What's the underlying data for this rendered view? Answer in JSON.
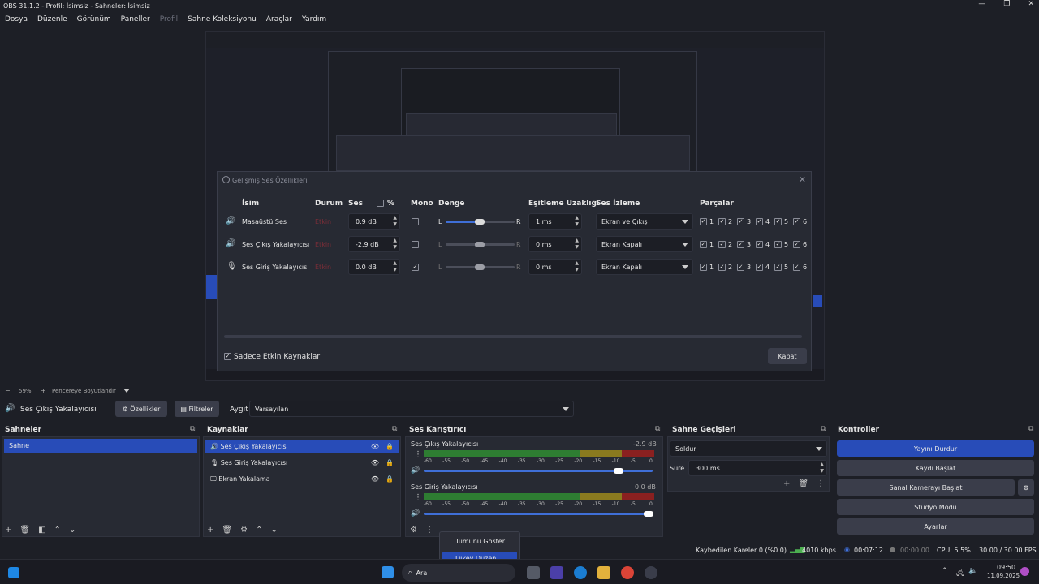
{
  "window": {
    "title": "OBS 31.1.2 - Profil: İsimsiz - Sahneler: İsimsiz",
    "controls": [
      "—",
      "❐",
      "✕"
    ]
  },
  "menu": {
    "items": [
      "Dosya",
      "Düzenle",
      "Görünüm",
      "Paneller",
      "Profil",
      "Sahne Koleksiyonu",
      "Araçlar",
      "Yardım"
    ]
  },
  "dialog": {
    "title": "Gelişmiş Ses Özellikleri",
    "headers": {
      "name": "İsim",
      "status": "Durum",
      "volume": "Ses",
      "percent": "%",
      "mono": "Mono",
      "balance": "Denge",
      "sync": "Eşitleme Uzaklığı",
      "monitor": "Ses İzleme",
      "tracks": "Parçalar"
    },
    "rows": [
      {
        "name": "Masaüstü Ses",
        "status": "Etkin",
        "volume": "0.9 dB",
        "mono": false,
        "balance": 0.5,
        "sync": "1 ms",
        "monitor": "Ekran ve Çıkış",
        "icon": "speaker-icon"
      },
      {
        "name": "Ses Çıkış Yakalayıcısı",
        "status": "Etkin",
        "volume": "-2.9 dB",
        "mono": false,
        "balance": 0.5,
        "sync": "0 ms",
        "monitor": "Ekran Kapalı",
        "icon": "speaker-icon"
      },
      {
        "name": "Ses Giriş Yakalayıcısı",
        "status": "Etkin",
        "volume": "0.0 dB",
        "mono": true,
        "balance": 0.5,
        "sync": "0 ms",
        "monitor": "Ekran Kapalı",
        "icon": "microphone-icon"
      }
    ],
    "track_labels": [
      "1",
      "2",
      "3",
      "4",
      "5",
      "6"
    ],
    "balance_l": "L",
    "balance_r": "R",
    "only_active": "Sadece Etkin Kaynaklar",
    "close": "Kapat"
  },
  "preview_bar": {
    "zoom": "59%",
    "fit": "Pencereye Boyutlandır"
  },
  "source_toolbar": {
    "source": "Ses Çıkış Yakalayıcısı",
    "properties": "Özellikler",
    "filters": "Filtreler",
    "device_label": "Aygıt",
    "device": "Varsayılan"
  },
  "scenes": {
    "title": "Sahneler",
    "items": [
      "Sahne"
    ]
  },
  "sources": {
    "title": "Kaynaklar",
    "items": [
      {
        "name": "Ses Çıkış Yakalayıcısı",
        "icon": "speaker-icon"
      },
      {
        "name": "Ses Giriş Yakalayıcısı",
        "icon": "microphone-icon"
      },
      {
        "name": "Ekran Yakalama",
        "icon": "monitor-icon"
      }
    ]
  },
  "mixer": {
    "title": "Ses Karıştırıcı",
    "channels": [
      {
        "name": "Ses Çıkış Yakalayıcısı",
        "db": "-2.9 dB",
        "volume": 0.85
      },
      {
        "name": "Ses Giriş Yakalayıcısı",
        "db": "0.0 dB",
        "volume": 1.0
      }
    ],
    "ticks": [
      "-60",
      "-55",
      "-50",
      "-45",
      "-40",
      "-35",
      "-30",
      "-25",
      "-20",
      "-15",
      "-10",
      "-5",
      "0"
    ]
  },
  "transitions": {
    "title": "Sahne Geçişleri",
    "type": "Soldur",
    "duration_label": "Süre",
    "duration": "300 ms"
  },
  "controls": {
    "title": "Kontroller",
    "buttons": [
      "Yayını Durdur",
      "Kaydı Başlat",
      "Sanal Kamerayı Başlat",
      "Stüdyo Modu",
      "Ayarlar"
    ]
  },
  "context_menu": {
    "items": [
      "Tümünü Göster",
      "Dikey Düzen"
    ]
  },
  "status": {
    "dropped": "Kaybedilen Kareler 0 (%0.0)",
    "bitrate": "4010 kbps",
    "stream_time": "00:07:12",
    "rec_time": "00:00:00",
    "cpu": "CPU: 5.5%",
    "fps": "30.00 / 30.00 FPS"
  },
  "taskbar": {
    "search": "Ara",
    "time": "09:50",
    "date": "11.09.2025"
  },
  "colors": {
    "accent": "#284cb8",
    "bg": "#1d1f26",
    "panel": "#272a33"
  }
}
